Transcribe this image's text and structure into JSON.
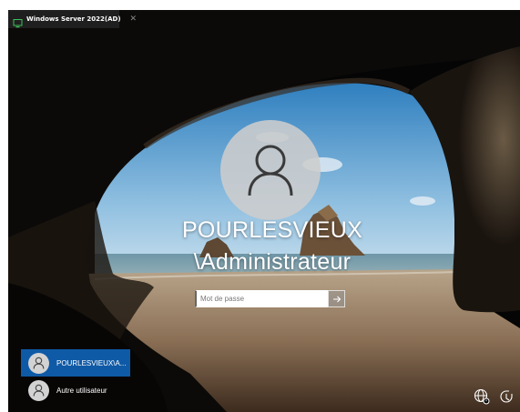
{
  "vm_tab": {
    "title": "Windows Server 2022(AD)",
    "close": "✕"
  },
  "lock_screen": {
    "user_name_line1": "POURLESVIEUX",
    "user_name_line2": "\\Administrateur",
    "password_placeholder": "Mot de passe",
    "submit_icon": "arrow-right-icon"
  },
  "user_list": [
    {
      "label": "POURLESVIEUX\\A...",
      "selected": true
    },
    {
      "label": "Autre utilisateur",
      "selected": false
    }
  ],
  "corner_icons": [
    "network-icon",
    "accessibility-icon"
  ],
  "colors": {
    "selected_user": "#0f5aa6",
    "avatar": "#cdcdcd"
  }
}
